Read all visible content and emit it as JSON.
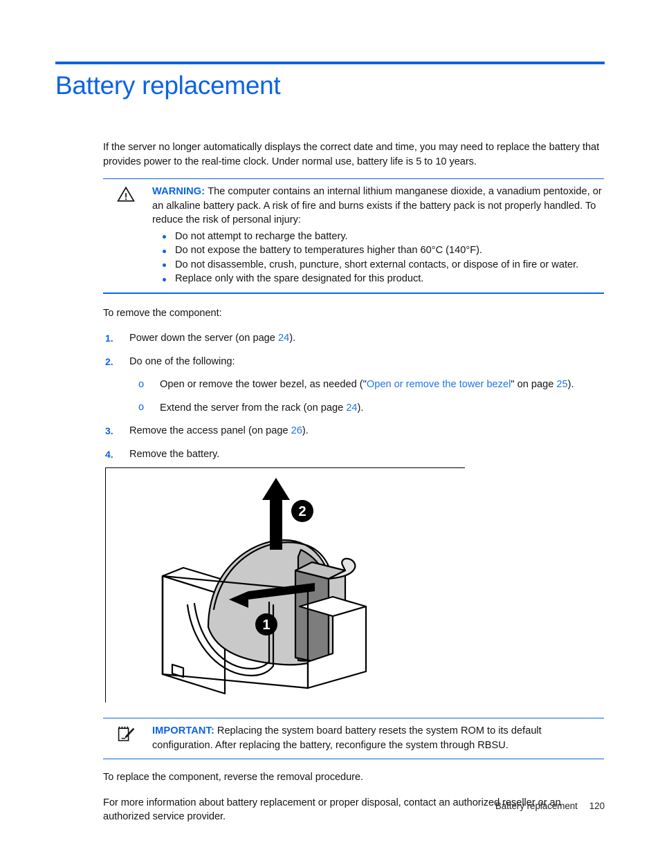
{
  "document": {
    "title": "Battery replacement",
    "accent_color": "#0b63e5",
    "link_color": "#1e74e8"
  },
  "intro": {
    "paragraph": "If the server no longer automatically displays the correct date and time, you may need to replace the battery that provides power to the real-time clock. Under normal use, battery life is 5 to 10 years."
  },
  "warning": {
    "icon": "warning-triangle-icon",
    "label": "WARNING:",
    "text": "The computer contains an internal lithium manganese dioxide, a vanadium pentoxide, or an alkaline battery pack. A risk of fire and burns exists if the battery pack is not properly handled. To reduce the risk of personal injury:",
    "bullets": [
      "Do not attempt to recharge the battery.",
      "Do not expose the battery to temperatures higher than 60°C (140°F).",
      "Do not disassemble, crush, puncture, short external contacts, or dispose of in fire or water.",
      "Replace only with the spare designated for this product."
    ]
  },
  "procedure": {
    "lead_in": "To remove the component:",
    "steps": [
      {
        "num": "1.",
        "text_before": "Power down the server (on page ",
        "page": "24",
        "text_after": ")."
      },
      {
        "num": "2.",
        "text_before": "Do one of the following:",
        "page": "",
        "text_after": "",
        "substeps": [
          {
            "marker": "o",
            "text_before": "Open or remove the tower bezel, as needed (\"",
            "link": "Open or remove the tower bezel",
            "text_mid": "\" on page ",
            "page": "25",
            "text_after": ")."
          },
          {
            "marker": "o",
            "text_before": "Extend the server from the rack (on page ",
            "link": "",
            "text_mid": "",
            "page": "24",
            "text_after": ")."
          }
        ]
      },
      {
        "num": "3.",
        "text_before": "Remove the access panel (on page ",
        "page": "26",
        "text_after": ")."
      },
      {
        "num": "4.",
        "text_before": "Remove the battery.",
        "page": "",
        "text_after": ""
      }
    ]
  },
  "figure": {
    "name": "battery-removal-illustration",
    "callouts": [
      {
        "id": "1",
        "meaning": "slide-battery-retaining-clip"
      },
      {
        "id": "2",
        "meaning": "lift-battery-out"
      }
    ]
  },
  "important": {
    "icon": "note-pad-pencil-icon",
    "label": "IMPORTANT:",
    "text": "Replacing the system board battery resets the system ROM to its default configuration. After replacing the battery, reconfigure the system through RBSU."
  },
  "closing": {
    "replace_paragraph": "To replace the component, reverse the removal procedure.",
    "info_paragraph": "For more information about battery replacement or proper disposal, contact an authorized reseller or an authorized service provider."
  },
  "footer": {
    "chapter": "Battery replacement",
    "page_number": "120"
  }
}
